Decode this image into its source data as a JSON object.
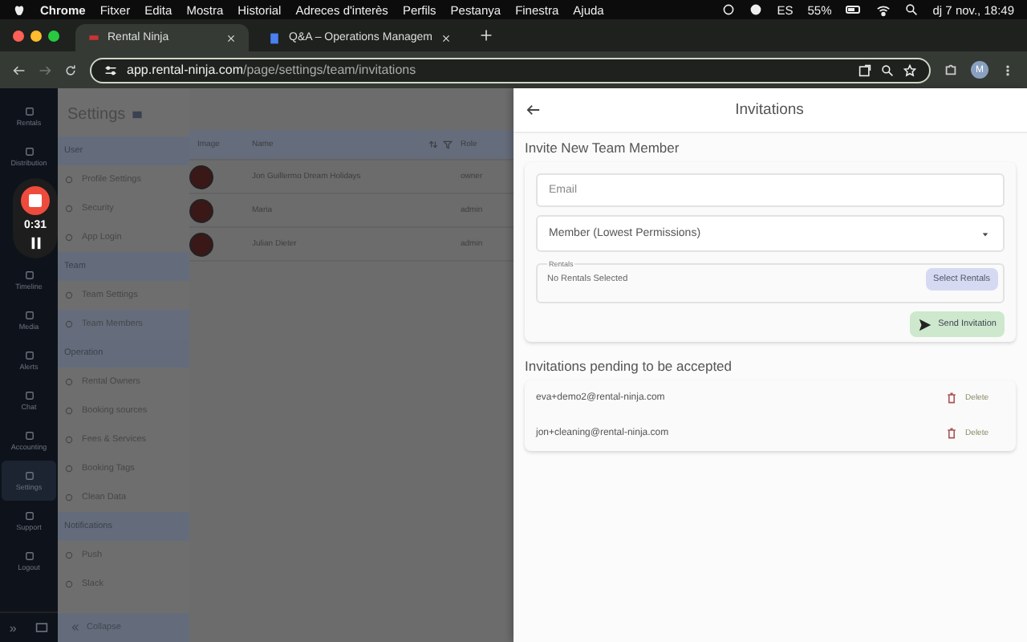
{
  "menubar": {
    "app": "Chrome",
    "menus": [
      "Fitxer",
      "Edita",
      "Mostra",
      "Historial",
      "Adreces d'interès",
      "Perfils",
      "Pestanya",
      "Finestra",
      "Ajuda"
    ],
    "input_source": "ES",
    "battery": "55%",
    "clock": "dj 7 nov., 18:49"
  },
  "browser": {
    "tabs": [
      {
        "title": "Rental Ninja",
        "selected": true
      },
      {
        "title": "Q&A – Operations Managem",
        "selected": false
      }
    ],
    "url_host": "app.rental-ninja.com",
    "url_path": "/page/settings/team/invitations",
    "profile": "M"
  },
  "nav": {
    "items": [
      {
        "label": "Rentals",
        "selected": false
      },
      {
        "label": "Distribution",
        "selected": false
      },
      {
        "label": "Timeline",
        "selected": false
      },
      {
        "label": "Media",
        "selected": false
      },
      {
        "label": "Alerts",
        "selected": false
      },
      {
        "label": "Chat",
        "selected": false
      },
      {
        "label": "Accounting",
        "selected": false
      },
      {
        "label": "Settings",
        "selected": true
      },
      {
        "label": "Support",
        "selected": false
      },
      {
        "label": "Logout",
        "selected": false
      }
    ],
    "expand": "»"
  },
  "recorder": {
    "time": "0:31"
  },
  "settings": {
    "title": "Settings",
    "sections": [
      {
        "title": "User",
        "items": [
          {
            "label": "Profile Settings",
            "selected": false
          },
          {
            "label": "Security",
            "selected": false
          },
          {
            "label": "App Login",
            "selected": false
          }
        ]
      },
      {
        "title": "Team",
        "items": [
          {
            "label": "Team Settings",
            "selected": false
          },
          {
            "label": "Team Members",
            "selected": true
          }
        ]
      },
      {
        "title": "Operation",
        "items": [
          {
            "label": "Rental Owners",
            "selected": false
          },
          {
            "label": "Booking sources",
            "selected": false
          },
          {
            "label": "Fees & Services",
            "selected": false
          },
          {
            "label": "Booking Tags",
            "selected": false
          },
          {
            "label": "Clean Data",
            "selected": false
          }
        ]
      },
      {
        "title": "Notifications",
        "items": [
          {
            "label": "Push",
            "selected": false
          },
          {
            "label": "Slack",
            "selected": false
          }
        ]
      }
    ],
    "collapse": "Collapse"
  },
  "members": {
    "columns": [
      "Image",
      "Name",
      "Role"
    ],
    "rows": [
      {
        "name": "Jon Guillermo Dream Holidays",
        "role": "owner"
      },
      {
        "name": "Maria",
        "role": "admin"
      },
      {
        "name": "Julian Dieter",
        "role": "admin"
      }
    ]
  },
  "invitations": {
    "title": "Invitations",
    "form_title": "Invite New Team Member",
    "email": {
      "placeholder": "Email"
    },
    "role": {
      "value": "Member (Lowest Permissions)"
    },
    "rentals": {
      "label": "Rentals",
      "value": "No Rentals Selected",
      "button": "Select Rentals"
    },
    "send": "Send Invitation",
    "pending_title": "Invitations pending to be accepted",
    "pending": [
      {
        "email": "eva+demo2@rental-ninja.com",
        "action": "Delete"
      },
      {
        "email": "jon+cleaning@rental-ninja.com",
        "action": "Delete"
      }
    ]
  }
}
